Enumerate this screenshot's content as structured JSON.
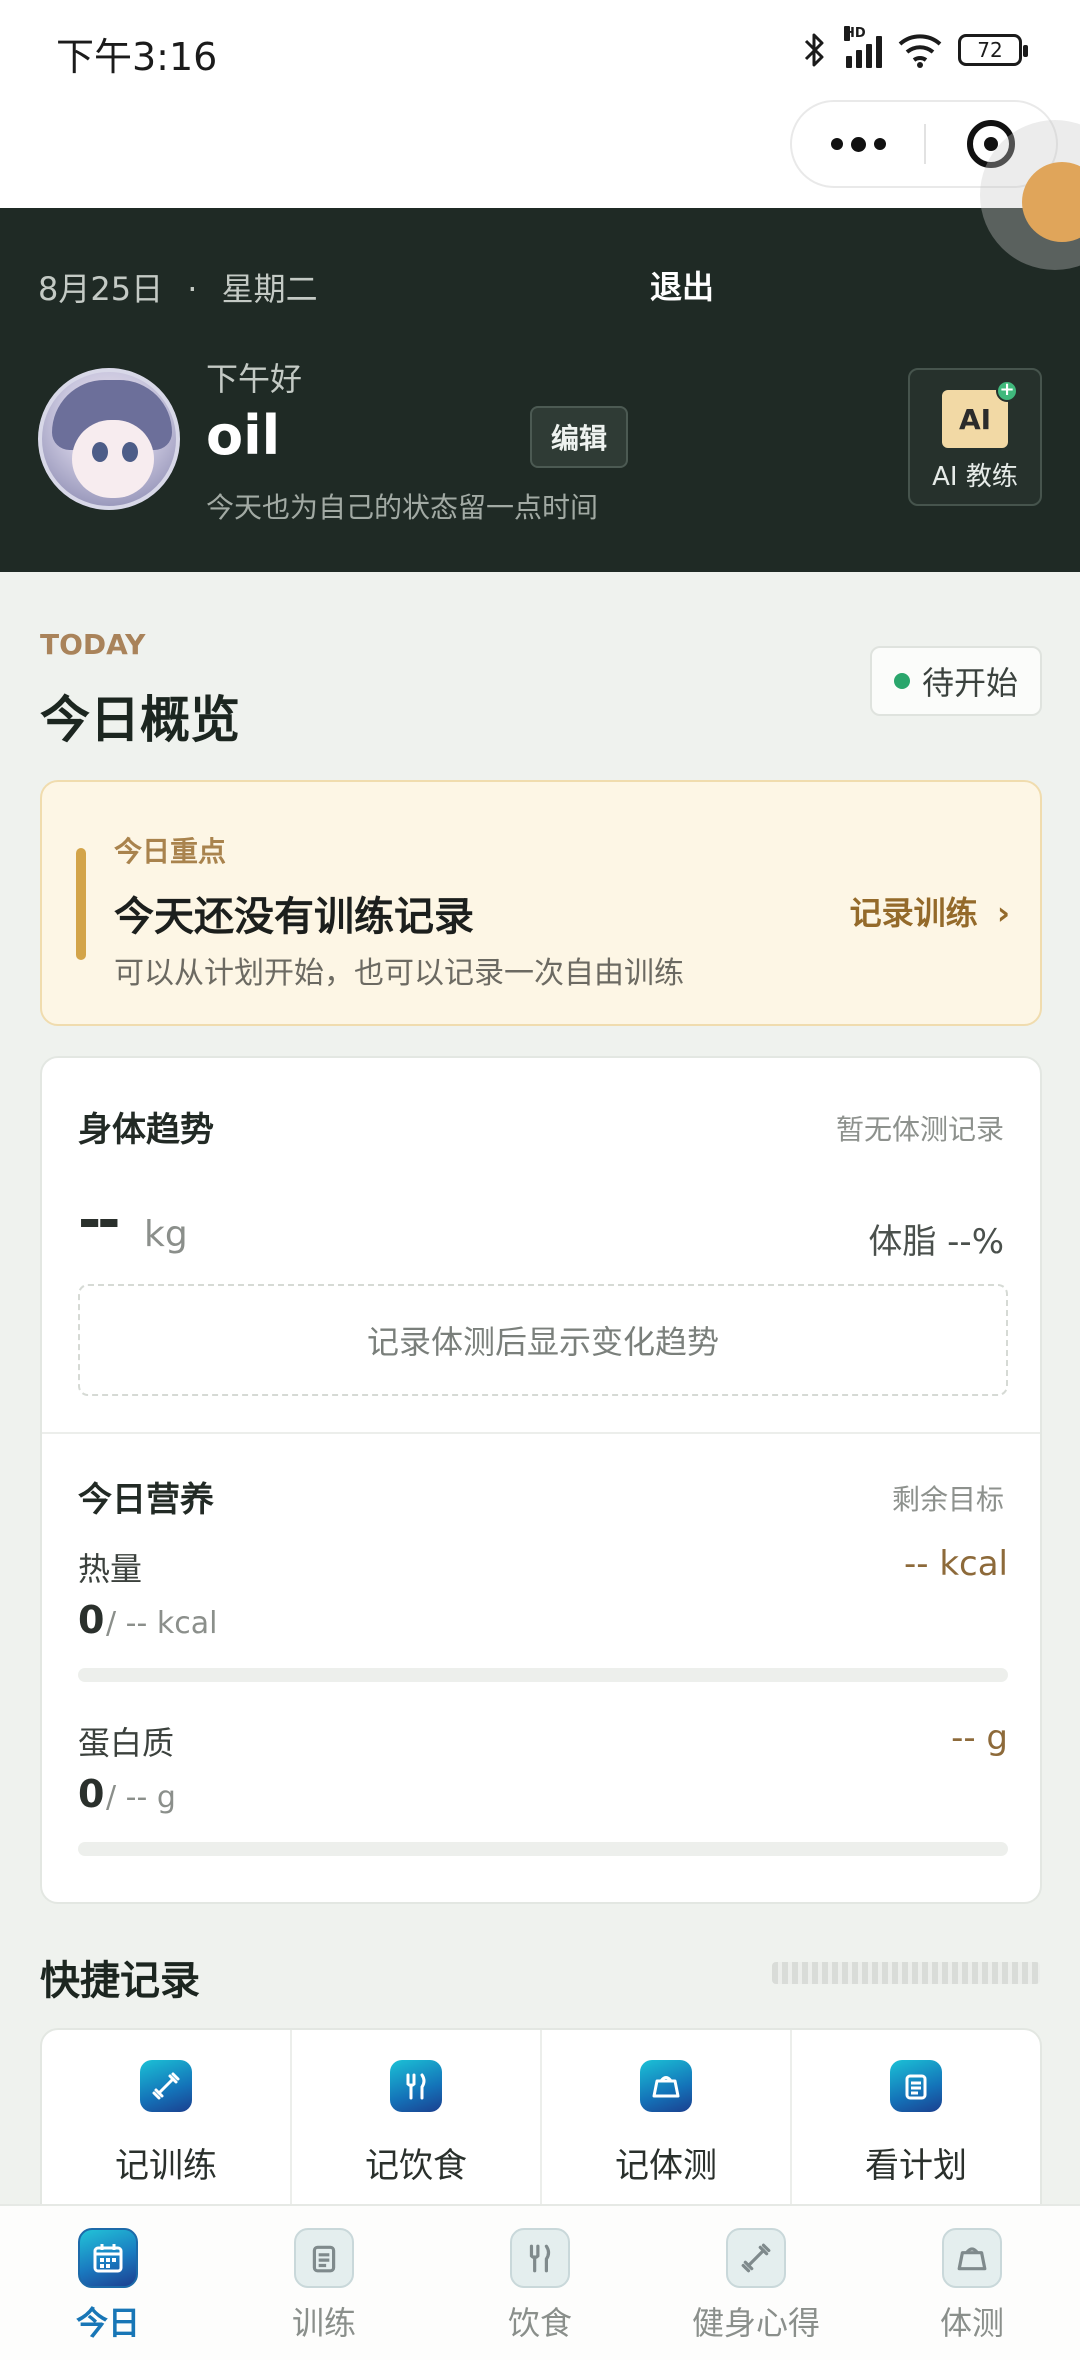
{
  "status_bar": {
    "time": "下午3:16",
    "signal_tag": "HD",
    "battery": "72"
  },
  "header": {
    "date": "8月25日",
    "separator": "·",
    "weekday": "星期二",
    "logout": "退出",
    "greeting": "下午好",
    "username": "oil",
    "edit": "编辑",
    "subtitle": "今天也为自己的状态留一点时间",
    "ai_badge": "AI",
    "ai_label": "AI 教练"
  },
  "overview": {
    "tag": "TODAY",
    "title": "今日概览",
    "status": "待开始",
    "status_color": "#2aa66c"
  },
  "focus": {
    "label": "今日重点",
    "title": "今天还没有训练记录",
    "subtitle": "可以从计划开始，也可以记录一次自由训练",
    "action": "记录训练",
    "action_chevron": "›"
  },
  "body_trend": {
    "title": "身体趋势",
    "note": "暂无体测记录",
    "weight_value": "--",
    "weight_unit": "kg",
    "body_fat": "体脂 --%",
    "placeholder": "记录体测后显示变化趋势"
  },
  "nutrition": {
    "title": "今日营养",
    "right_label": "剩余目标",
    "rows": [
      {
        "name": "热量",
        "remaining": "-- kcal",
        "value": "0",
        "goal": "/ -- kcal",
        "progress": 0
      },
      {
        "name": "蛋白质",
        "remaining": "-- g",
        "value": "0",
        "goal": "/ -- g",
        "progress": 0
      }
    ]
  },
  "quick": {
    "title": "快捷记录",
    "items": [
      {
        "label": "记训练",
        "icon": "dumbbell-icon"
      },
      {
        "label": "记饮食",
        "icon": "utensils-icon"
      },
      {
        "label": "记体测",
        "icon": "scale-icon"
      },
      {
        "label": "看计划",
        "icon": "clipboard-icon"
      }
    ]
  },
  "tabbar": {
    "tabs": [
      {
        "label": "今日",
        "icon": "calendar-icon",
        "active": true
      },
      {
        "label": "训练",
        "icon": "clipboard-icon",
        "active": false
      },
      {
        "label": "饮食",
        "icon": "utensils-icon",
        "active": false
      },
      {
        "label": "健身心得",
        "icon": "dumbbell-icon",
        "active": false
      },
      {
        "label": "体测",
        "icon": "scale-icon",
        "active": false
      }
    ],
    "active_color": "#1876b6"
  },
  "colors": {
    "header_bg": "#1f2a25",
    "accent_gold": "#d3a449",
    "page_bg": "#eff2ee"
  }
}
